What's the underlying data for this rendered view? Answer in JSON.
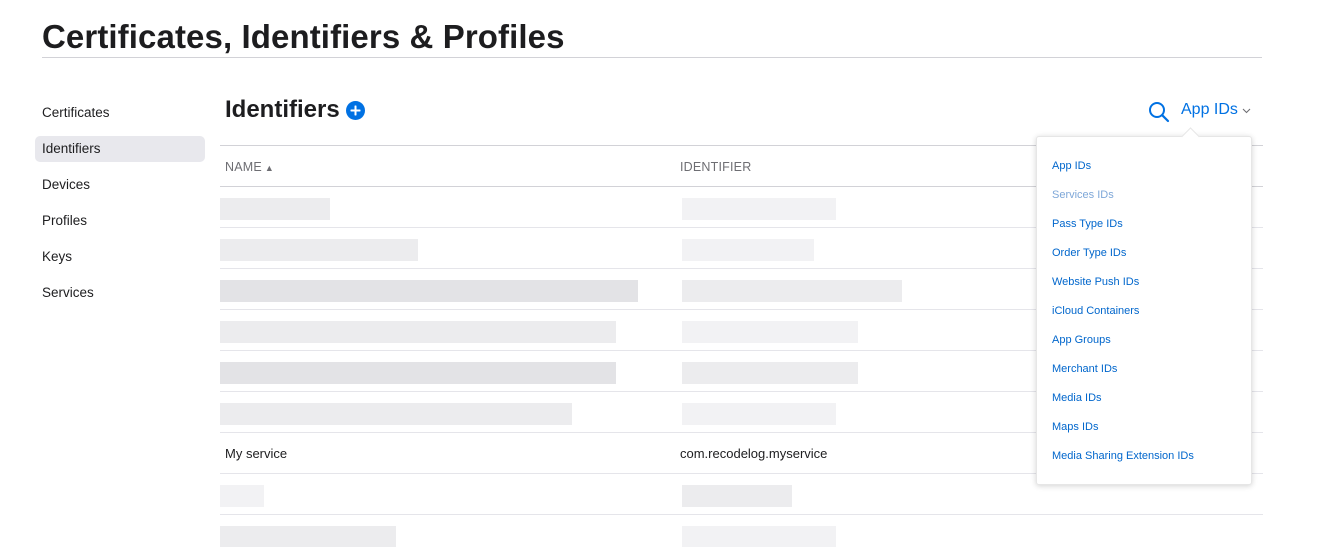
{
  "page": {
    "title": "Certificates, Identifiers & Profiles"
  },
  "sidebar": {
    "items": [
      {
        "label": "Certificates"
      },
      {
        "label": "Identifiers",
        "active": true
      },
      {
        "label": "Devices"
      },
      {
        "label": "Profiles"
      },
      {
        "label": "Keys"
      },
      {
        "label": "Services"
      }
    ]
  },
  "section": {
    "title": "Identifiers",
    "add_icon": "plus-circle-icon",
    "search_icon": "search-icon",
    "filter_selected": "App IDs",
    "filter_chevron_icon": "chevron-down-icon"
  },
  "table": {
    "columns": {
      "name": "NAME",
      "identifier": "IDENTIFIER"
    },
    "sort_icon": "sort-ascending-icon",
    "visible_row": {
      "name": "My service",
      "identifier": "com.recodelog.myservice"
    }
  },
  "dropdown": {
    "options": [
      {
        "label": "App IDs"
      },
      {
        "label": "Services IDs",
        "disabled": true
      },
      {
        "label": "Pass Type IDs"
      },
      {
        "label": "Order Type IDs"
      },
      {
        "label": "Website Push IDs"
      },
      {
        "label": "iCloud Containers"
      },
      {
        "label": "App Groups"
      },
      {
        "label": "Merchant IDs"
      },
      {
        "label": "Media IDs"
      },
      {
        "label": "Maps IDs"
      },
      {
        "label": "Media Sharing Extension IDs"
      }
    ]
  },
  "colors": {
    "accent": "#0071e3",
    "link": "#0066cc",
    "text": "#1d1d1f",
    "muted": "#6e6e73"
  }
}
